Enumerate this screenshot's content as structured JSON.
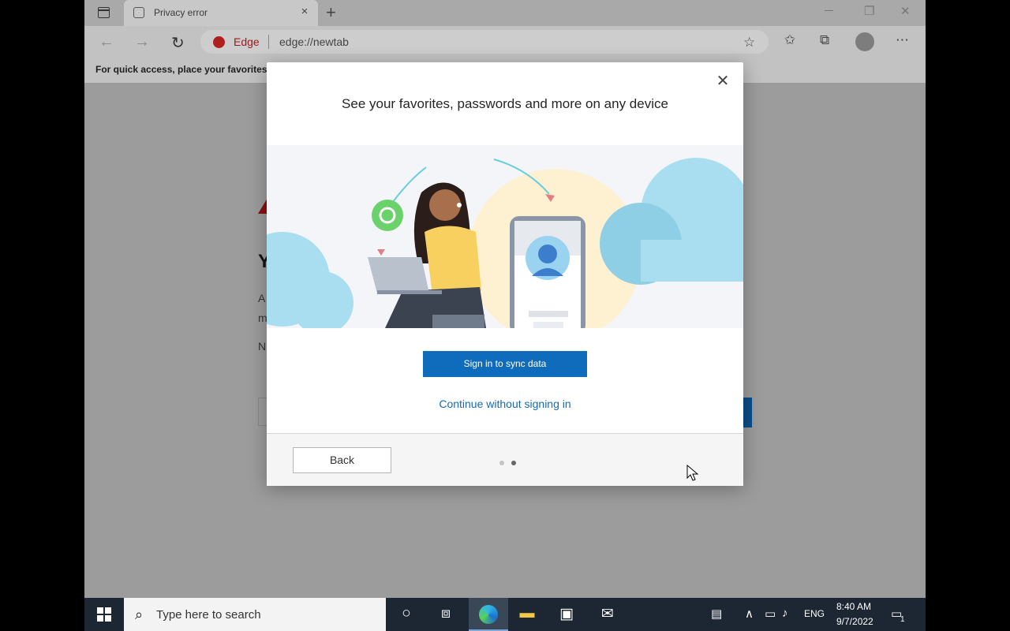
{
  "browser": {
    "tab_title": "Privacy error",
    "tab_close": "×",
    "new_tab": "+",
    "address": {
      "brand": "Edge",
      "url": "edge://newtab"
    },
    "favorites_bar_text": "For quick access, place your favorites h"
  },
  "page": {
    "heading_fragment": "Y",
    "line1_fragment": "A",
    "line2_fragment": "m",
    "line3_fragment": "N"
  },
  "modal": {
    "close_glyph": "✕",
    "title": "See your favorites, passwords and more on any device",
    "sign_in_button": "Sign in to sync data",
    "continue_link": "Continue without signing in",
    "back_button": "Back",
    "pager": {
      "total": 2,
      "current": 2
    },
    "colors": {
      "primary": "#0f6cbd",
      "link": "#1769b5"
    }
  },
  "taskbar": {
    "search_placeholder": "Type here to search",
    "language": "ENG",
    "time": "8:40 AM",
    "date": "9/7/2022",
    "notification_count": "1"
  },
  "icons": [
    "sidebar-toggle-icon",
    "page-favicon-icon",
    "back-icon",
    "forward-icon",
    "refresh-icon",
    "add-favorite-icon",
    "favorites-icon",
    "collections-icon",
    "profile-icon",
    "more-icon",
    "windows-start-icon",
    "search-icon",
    "cortana-icon",
    "task-view-icon",
    "edge-icon",
    "file-explorer-icon",
    "store-icon",
    "mail-icon",
    "news-icon",
    "chevron-up-icon",
    "network-icon",
    "volume-icon",
    "notification-icon"
  ]
}
